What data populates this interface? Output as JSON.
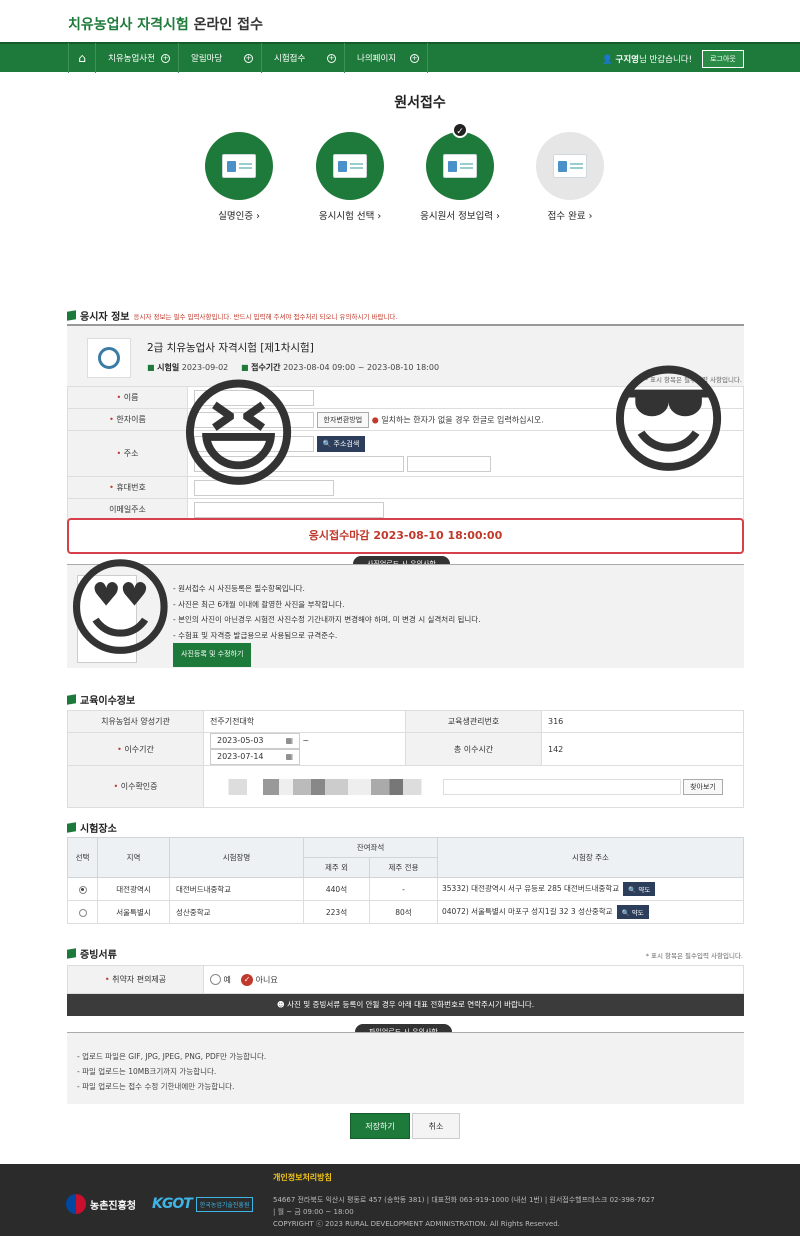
{
  "header": {
    "site_title_green": "치유농업사 자격시험",
    "site_title_rest": " 온라인 접수",
    "nav": [
      "치유농업사전",
      "알림마당",
      "시험접수",
      "나의페이지"
    ],
    "user_name": "구지영",
    "user_greeting": "님 반갑습니다!",
    "logout": "로그아웃"
  },
  "page_title": "원서접수",
  "steps": [
    {
      "label": "실명인증 ›",
      "active": true
    },
    {
      "label": "응시시험 선택 ›",
      "active": true
    },
    {
      "label": "응시원서 정보입력 ›",
      "active": true,
      "current": true
    },
    {
      "label": "접수 완료 ›",
      "active": false
    }
  ],
  "applicant": {
    "heading": "응시자 정보",
    "note": "응시자 정보는 필수 입력사항입니다. 반드시 입력해 주셔야 접수처리 되오니 유의하시기 바랍니다.",
    "exam_title": "2급 치유농업사 자격시험 [제1차시험]",
    "exam_date_label": "시험일",
    "exam_date": "2023-09-02",
    "period_label": "접수기간",
    "period": "2023-08-04 09:00 ~ 2023-08-10 18:00",
    "req_note": "* 표시 항목은 필수입력 사항입니다.",
    "fields": {
      "name": "이름",
      "hanja": "한자이름",
      "hanja_btn": "한자변환방법",
      "hanja_note": "일치하는 한자가 없을 경우 한글로 입력하십시오.",
      "address": "주소",
      "address_btn": "주소검색",
      "phone": "휴대번호",
      "email": "이메일주소"
    },
    "deadline": "응시접수마감 2023-08-10 18:00:00",
    "photo_pill": "사진업로드 시 유의사항",
    "photo_notes": [
      "- 원서접수 시 사진등록은 필수항목입니다.",
      "- 사진은 최근 6개월 이내에 촬영한 사진을 부착합니다.",
      "- 본인의 사진이 아닌경우 시험전 사진수정 기간내까지 변경해야 하며, 미 변경 시 실격처리 됩니다.",
      "- 수험표 및 자격증 발급용으로 사용됨으로 규격준수."
    ],
    "photo_btn": "사진등록 및 수정하기"
  },
  "education": {
    "heading": "교육이수정보",
    "org_label": "치유농업사 양성기관",
    "org_value": "전주기전대학",
    "mgmt_label": "교육생관리번호",
    "mgmt_value": "316",
    "period_label": "이수기간",
    "start": "2023-05-03",
    "end": "2023-07-14",
    "hours_label": "총 이수시간",
    "hours_value": "142",
    "cert_label": "이수확인증",
    "browse_btn": "찾아보기"
  },
  "sites": {
    "heading": "시험장소",
    "cols": [
      "선택",
      "지역",
      "시험장명",
      "잔여좌석",
      "제주 외",
      "제주 전용",
      "시험장 주소"
    ],
    "rows": [
      {
        "region": "대전광역시",
        "name": "대전버드내중학교",
        "outside": "440석",
        "jeju": "-",
        "address": "35332) 대전광역시 서구 유등로 285 대전버드내중학교",
        "selected": true
      },
      {
        "region": "서울특별시",
        "name": "성산중학교",
        "outside": "223석",
        "jeju": "80석",
        "address": "04072) 서울특별시 마포구 성지1길 32 3 성산중학교",
        "selected": false
      }
    ],
    "map_btn": "약도"
  },
  "docs": {
    "heading": "증빙서류",
    "req_note": "* 표시 항목은 필수입력 사항입니다.",
    "acc_label": "취약자 편의제공",
    "opt_yes": "예",
    "opt_no": "아니요",
    "notice": "사진 및 증빙서류 등록이 안될 경우 아래 대표 전화번호로 연락주시기 바랍니다.",
    "upload_pill": "파일업로드 시 유의사항",
    "upload_notes": [
      "- 업로드 파일은 GIF, JPG, JPEG, PNG, PDF만 가능합니다.",
      "- 파일 업로드는 10MB크기까지 가능합니다.",
      "- 파일 업로드는 접수 수정 기한내에만 가능합니다."
    ]
  },
  "buttons": {
    "save": "저장하기",
    "cancel": "취소"
  },
  "footer": {
    "privacy": "개인정보처리방침",
    "line1": "54667 전라북도 익산시 평동로 457 (송학동 381)  |  대표전화 063-919-1000 (내선 1번)  |  원서접수헬프데스크 02-398-7627",
    "line2": "| 월 ~ 금 09:00 ~ 18:00",
    "line3": "COPYRIGHT ⓒ 2023 RURAL DEVELOPMENT ADMINISTRATION. All Rights Reserved.",
    "logo1": "농촌진흥청",
    "logo2_main": "KGOT",
    "logo2_sub": "한국농업기술진흥원"
  },
  "emojis": {
    "grin": "😆",
    "cool": "😎",
    "heart_eyes": "😍"
  },
  "colors": {
    "brand_green": "#1e7a3a",
    "deadline_red": "#d6404a",
    "navy": "#2c3e5c"
  }
}
